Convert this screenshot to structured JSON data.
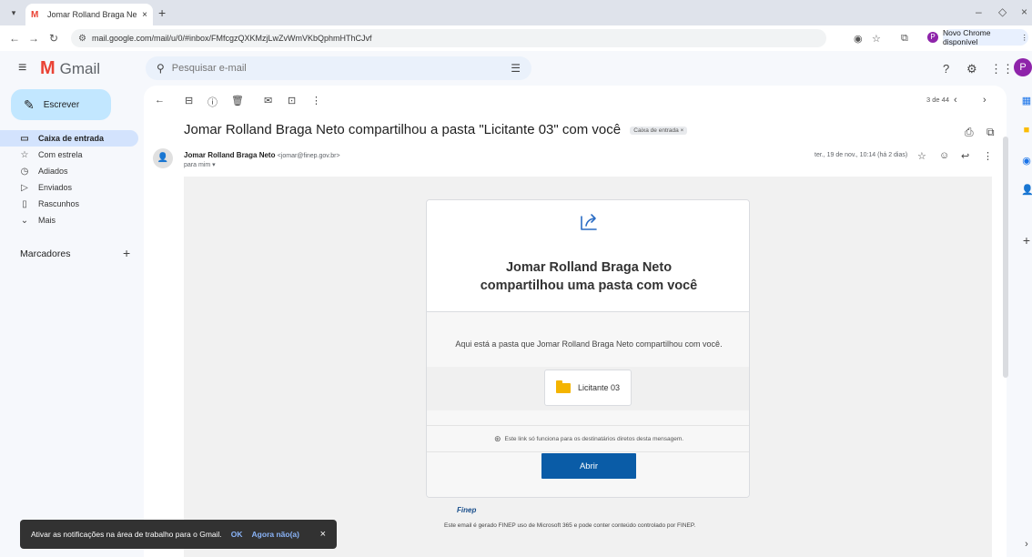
{
  "browser": {
    "tab_title": "Jomar Rolland Braga Neto com",
    "url": "mail.google.com/mail/u/0/#inbox/FMfcgzQXKMzjLwZvWmVKbQphmHThCJvf",
    "profile_initial": "P",
    "update_label": "Novo Chrome disponível"
  },
  "gmail": {
    "brand": "Gmail",
    "search_placeholder": "Pesquisar e-mail",
    "avatar_initial": "P",
    "compose_label": "Escrever",
    "nav": [
      {
        "label": "Caixa de entrada",
        "active": true,
        "icon": "inbox-icon"
      },
      {
        "label": "Com estrela",
        "active": false,
        "icon": "star-icon"
      },
      {
        "label": "Adiados",
        "active": false,
        "icon": "clock-icon"
      },
      {
        "label": "Enviados",
        "active": false,
        "icon": "send-icon"
      },
      {
        "label": "Rascunhos",
        "active": false,
        "icon": "draft-icon"
      },
      {
        "label": "Mais",
        "active": false,
        "icon": "chevron-down-icon"
      }
    ],
    "labels_header": "Marcadores",
    "counter": "3 de 44"
  },
  "message": {
    "subject": "Jomar Rolland Braga Neto compartilhou a pasta \"Licitante 03\" com você",
    "label_badge": "Caixa de entrada ×",
    "sender_name": "Jomar Rolland Braga Neto",
    "sender_email": "<jomar@finep.gov.br>",
    "to": "para mim ▾",
    "date": "ter., 19 de nov., 10:14 (há 2 dias)"
  },
  "email_body": {
    "title_line1": "Jomar Rolland Braga Neto",
    "title_line2": "compartilhou uma pasta com você",
    "description": "Aqui está a pasta que Jomar Rolland Braga Neto compartilhou com você.",
    "folder_name": "Licitante 03",
    "note": "Este link só funciona para os destinatários diretos desta mensagem.",
    "button": "Abrir",
    "footer_brand": "Finep",
    "footer": "Este email é gerado FINEP uso de Microsoft 365 e pode conter conteúdo controlado por FINEP."
  },
  "snackbar": {
    "text": "Ativar as notificações na área de trabalho para o Gmail.",
    "ok": "OK",
    "later": "Agora não(a)"
  },
  "colors": {
    "accent": "#0a5ca7",
    "compose_bg": "#c2e7ff",
    "active_nav": "#d3e3fd",
    "avatar": "#8e24aa"
  }
}
